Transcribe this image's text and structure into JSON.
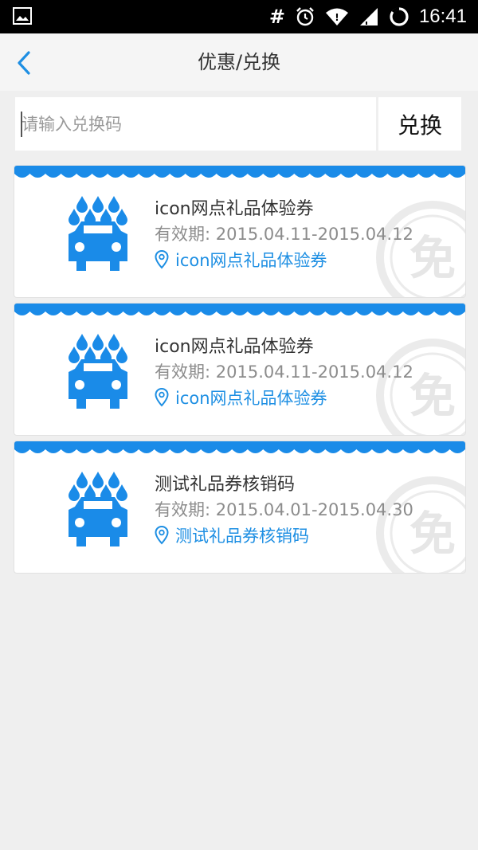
{
  "status_bar": {
    "time": "16:41",
    "hash_symbol": "#",
    "icons": [
      "image-icon",
      "alarm-icon",
      "wifi-icon",
      "signal-icon",
      "battery-icon"
    ]
  },
  "nav": {
    "title": "优惠/兑换",
    "back_icon": "chevron-left-icon"
  },
  "redeem": {
    "placeholder": "请输入兑换码",
    "value": "",
    "button_label": "兑换"
  },
  "coupons": [
    {
      "title": "icon网点礼品体验券",
      "validity_prefix": "有效期: ",
      "validity_range": "2015.04.11-2015.04.12",
      "location": "icon网点礼品体验券",
      "icon": "car-wash-icon",
      "stamp_text": "免"
    },
    {
      "title": "icon网点礼品体验券",
      "validity_prefix": "有效期: ",
      "validity_range": "2015.04.11-2015.04.12",
      "location": "icon网点礼品体验券",
      "icon": "car-wash-icon",
      "stamp_text": "免"
    },
    {
      "title": "测试礼品券核销码",
      "validity_prefix": "有效期: ",
      "validity_range": "2015.04.01-2015.04.30",
      "location": "测试礼品券核销码",
      "icon": "car-wash-icon",
      "stamp_text": "免"
    }
  ],
  "colors": {
    "accent": "#1e8fe3",
    "icon_blue": "#1a8be8",
    "background": "#efefef"
  }
}
